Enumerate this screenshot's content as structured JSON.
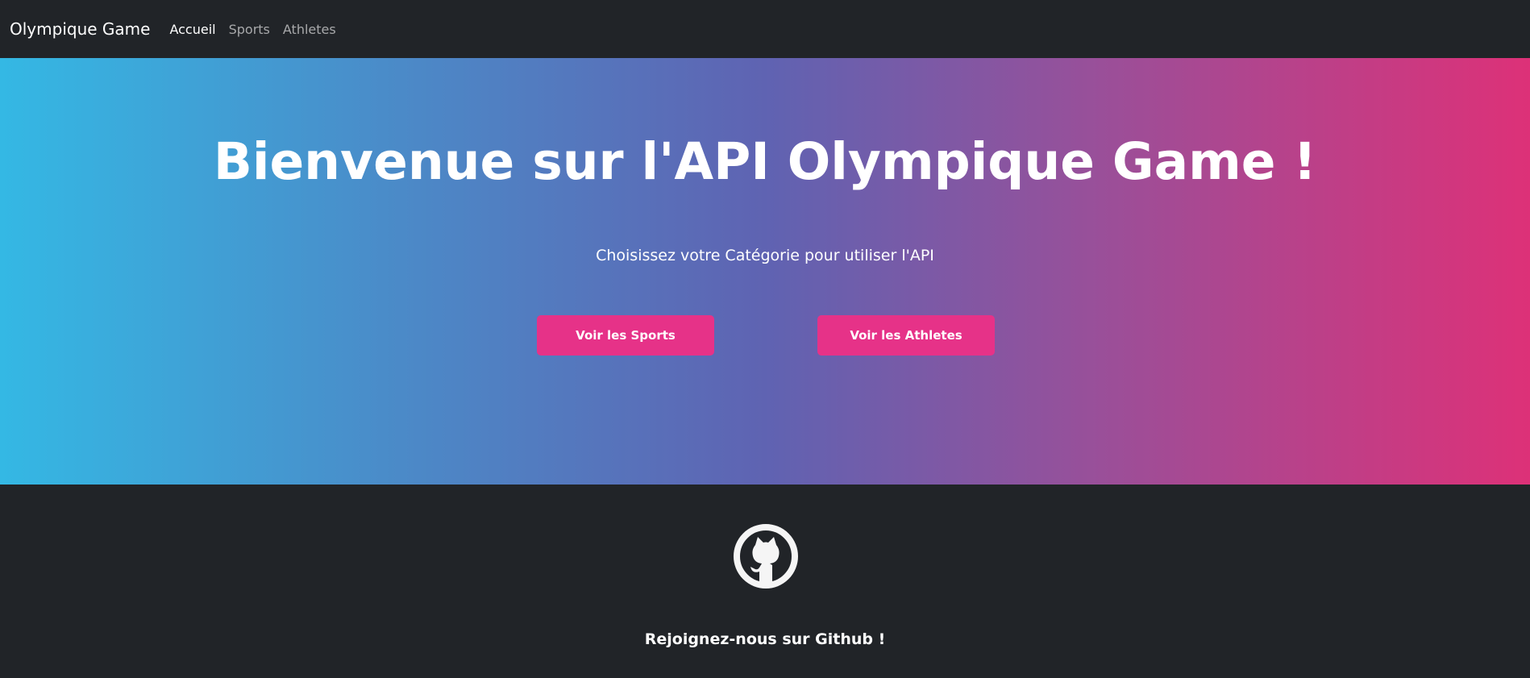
{
  "navbar": {
    "brand": "Olympique Game",
    "links": [
      {
        "label": "Accueil",
        "active": true
      },
      {
        "label": "Sports",
        "active": false
      },
      {
        "label": "Athletes",
        "active": false
      }
    ]
  },
  "hero": {
    "title": "Bienvenue sur l'API Olympique Game !",
    "subtitle": "Choisissez votre Catégorie pour utiliser l'API",
    "buttons": [
      {
        "label": "Voir les Sports"
      },
      {
        "label": "Voir les Athletes"
      }
    ],
    "gradient_colors": [
      "#34b8e4",
      "#5f63b2",
      "#dd3178"
    ]
  },
  "footer": {
    "icon": "github-icon",
    "text": "Rejoignez-nous sur Github !"
  },
  "colors": {
    "navbar_bg": "#212428",
    "button_bg": "#e63288",
    "text": "#ffffff"
  }
}
